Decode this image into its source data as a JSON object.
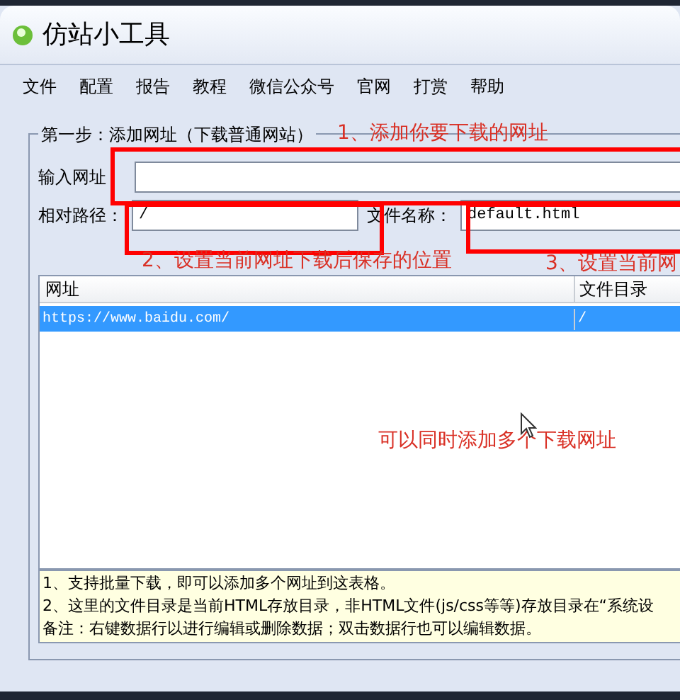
{
  "window": {
    "title": "仿站小工具"
  },
  "menu": [
    "文件",
    "配置",
    "报告",
    "教程",
    "微信公众号",
    "官网",
    "打赏",
    "帮助"
  ],
  "group": {
    "legend": "第一步：添加网址（下载普通网站）"
  },
  "url_field": {
    "label": "输入网址"
  },
  "path_field": {
    "label": "相对路径：",
    "value": "/"
  },
  "name_field": {
    "label": "文件名称：",
    "value": "default.html"
  },
  "table": {
    "columns": [
      "网址",
      "文件目录"
    ],
    "rows": [
      {
        "cells": [
          "https://www.baidu.com/",
          "/"
        ],
        "selected": true
      }
    ]
  },
  "notes": [
    "1、支持批量下载，即可以添加多个网址到这表格。",
    "2、这里的文件目录是当前HTML存放目录，非HTML文件(js/css等等)存放目录在“系统设",
    "备注：右键数据行以进行编辑或删除数据；双击数据行也可以编辑数据。"
  ],
  "annotations": [
    {
      "text": "1、添加你要下载的网址"
    },
    {
      "text": "2、设置当前网址下载后保存的位置"
    },
    {
      "text": "3、设置当前网"
    },
    {
      "text": "可以同时添加多个下载网址"
    }
  ]
}
